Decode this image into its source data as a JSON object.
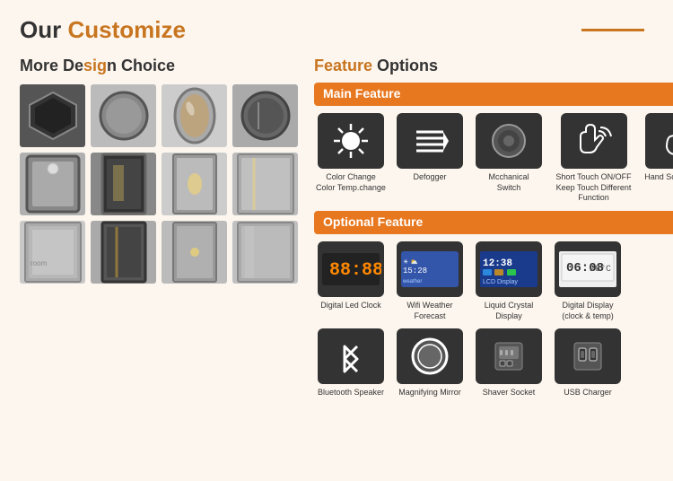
{
  "header": {
    "title_plain": "Our ",
    "title_accent": "Customize"
  },
  "left": {
    "section_title_plain": "More De",
    "section_title_accent": "sig",
    "section_title_rest": "n Choice",
    "shapes": [
      {
        "id": "hexagon",
        "label": "Hexagon"
      },
      {
        "id": "round-light",
        "label": "Round"
      },
      {
        "id": "oval-light",
        "label": "Oval"
      },
      {
        "id": "round-dark",
        "label": "Round"
      }
    ],
    "rows": [
      [
        "rect-bright",
        "rect-dark",
        "rect-med",
        "rect-light"
      ],
      [
        "rect-wide1",
        "rect-wide2",
        "rect-wide3",
        "rect-wide4"
      ]
    ]
  },
  "right": {
    "section_title_plain": "",
    "section_title_accent": "Feature",
    "section_title_rest": " Options",
    "main_feature_label": "Main Feature",
    "main_features": [
      {
        "id": "color-change",
        "label": "Color Change\nColor Temp.change",
        "icon": "sun"
      },
      {
        "id": "defogger",
        "label": "Defogger",
        "icon": "defog"
      },
      {
        "id": "mech-switch",
        "label": "Mcchanical\nSwitch",
        "icon": "switch"
      },
      {
        "id": "short-touch",
        "label": "Short Touch ON/OFF\nKeep Touch Different\nFunction",
        "icon": "touch"
      },
      {
        "id": "hand-scan",
        "label": "Hand Scan Sensor",
        "icon": "hand"
      }
    ],
    "optional_feature_label": "Optional Feature",
    "optional_features_row1": [
      {
        "id": "led-clock",
        "label": "Digital Led Clock",
        "icon": "led-clock"
      },
      {
        "id": "wifi-weather",
        "label": "Wifi Weather Forecast",
        "icon": "weather"
      },
      {
        "id": "lcd",
        "label": "Liquid Crystal Display",
        "icon": "lcd"
      },
      {
        "id": "digital-display",
        "label": "Digital Display\n(clock & temp)",
        "icon": "digital"
      }
    ],
    "optional_features_row2": [
      {
        "id": "bluetooth",
        "label": "Bluetooth Speaker",
        "icon": "bluetooth"
      },
      {
        "id": "magnify",
        "label": "Magnifying Mirror",
        "icon": "magnify"
      },
      {
        "id": "shaver",
        "label": "Shaver Socket",
        "icon": "shaver"
      },
      {
        "id": "usb",
        "label": "USB Charger",
        "icon": "usb"
      }
    ]
  },
  "colors": {
    "accent": "#c87520",
    "orange_band": "#e87820",
    "bg": "#fdf6ee"
  }
}
